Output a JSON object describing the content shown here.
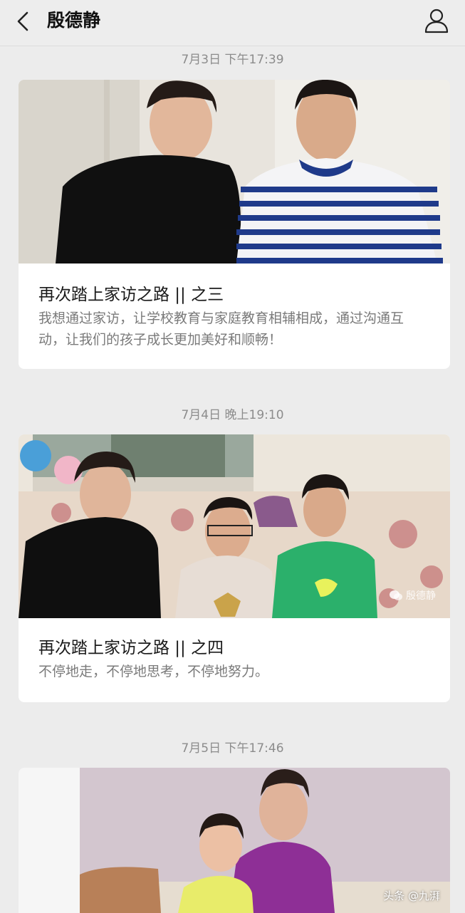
{
  "header": {
    "title": "殷德静",
    "back_icon": "chevron-left-icon",
    "profile_icon": "user-icon"
  },
  "articles": [
    {
      "timestamp": "7月3日 下午17:39",
      "title": "再次踏上家访之路 || 之三",
      "description": "我想通过家访，让学校教育与家庭教育相辅相成，通过沟通互动，让我们的孩子成长更加美好和顺畅！"
    },
    {
      "timestamp": "7月4日 晚上19:10",
      "title": "再次踏上家访之路 || 之四",
      "description": "不停地走，不停地思考，不停地努力。",
      "watermark": "殷德静"
    },
    {
      "timestamp": "7月5日 下午17:46"
    }
  ],
  "credit": "头条 @九湃"
}
